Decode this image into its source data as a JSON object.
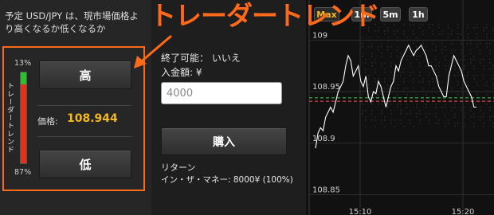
{
  "question": "予定 USD/JPY は、現市場価格より高くなるか低くなるか",
  "annotation": "トレーダートレンド",
  "trend": {
    "label": "トレーダートレンド",
    "high_pct_label": "13%",
    "low_pct_label": "87%",
    "high_fraction": 0.13,
    "high_color": "#29c12c",
    "low_color": "#e5301b"
  },
  "buttons": {
    "high": "高",
    "low": "低",
    "buy": "購入"
  },
  "price": {
    "label": "価格:",
    "value": "108.944"
  },
  "order": {
    "expiry": "終了可能： いいえ",
    "deposit_label": "入金額: ¥",
    "amount_value": "4000",
    "return_label": "リターン",
    "itm_line": "イン・ザ・マネー: 8000¥ (100%)"
  },
  "chart": {
    "range_buttons": [
      {
        "label": "Max",
        "active": true
      },
      {
        "label": "1m",
        "active": false
      },
      {
        "label": "5m",
        "active": false
      },
      {
        "label": "1h",
        "active": false
      }
    ],
    "colors": {
      "accent": "#f5b920",
      "line": "#ffffff",
      "current_price": "#3ed14a",
      "strike": "#ff5050"
    }
  },
  "chart_data": {
    "type": "line",
    "title": "",
    "xlabel": "",
    "ylabel": "",
    "x_ticks": [
      "15:10",
      "15:20"
    ],
    "y_ticks": [
      "109",
      "108.95",
      "108.9",
      "108.85"
    ],
    "y_tick_values": [
      109.0,
      108.95,
      108.9,
      108.85
    ],
    "ylim": [
      108.838,
      109.008
    ],
    "current_price": 108.944,
    "strike": 108.943,
    "series": [
      {
        "values": [
          108.895,
          108.91,
          108.915,
          108.912,
          108.925,
          108.93,
          108.935,
          108.93,
          108.94,
          108.95,
          108.955,
          108.96,
          108.975,
          108.985,
          108.98,
          108.965,
          108.97,
          108.975,
          108.96,
          108.955,
          108.965,
          108.945,
          108.94,
          108.95,
          108.948,
          108.96,
          108.955,
          108.945,
          108.935,
          108.945,
          108.955,
          108.96,
          108.975,
          108.97,
          108.98,
          108.985,
          108.99,
          108.995,
          108.99,
          108.985,
          108.99,
          108.992,
          108.995,
          108.99,
          108.985,
          108.975,
          108.975,
          108.97,
          108.965,
          108.955,
          108.95,
          108.945,
          108.945,
          108.965,
          108.975,
          108.985,
          108.98,
          108.975,
          108.97,
          108.96,
          108.955,
          108.95,
          108.945,
          108.935,
          108.935
        ]
      }
    ]
  }
}
